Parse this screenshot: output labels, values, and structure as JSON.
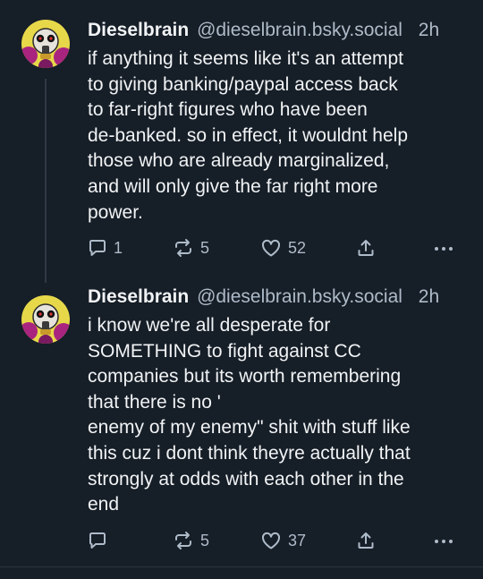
{
  "colors": {
    "background": "#161e27",
    "text": "#f1f3f5",
    "muted": "#aebbc9",
    "thread_line": "#2f3a47",
    "avatar_bg": "#e7d84a",
    "avatar_accent": "#a9247f"
  },
  "posts": [
    {
      "avatar_icon": "gas-mask-avatar-icon",
      "display_name": "Dieselbrain",
      "handle": "@dieselbrain.bsky.social",
      "time": "2h",
      "text": "if anything it seems like it's an attempt\nto giving banking/paypal access back\nto far-right figures who have been\nde-banked. so in effect, it wouldnt help\nthose who are already marginalized,\nand will only give the far right more\npower.",
      "reply_count": "1",
      "repost_count": "5",
      "like_count": "52"
    },
    {
      "avatar_icon": "gas-mask-avatar-icon",
      "display_name": "Dieselbrain",
      "handle": "@dieselbrain.bsky.social",
      "time": "2h",
      "text": "i know we're all desperate for\nSOMETHING to fight against CC\ncompanies but its worth remembering\nthat there is no '\nenemy of my enemy\" shit with stuff like\nthis cuz i dont think theyre actually that\nstrongly at odds with each other in the\nend",
      "reply_count": "",
      "repost_count": "5",
      "like_count": "37"
    }
  ]
}
